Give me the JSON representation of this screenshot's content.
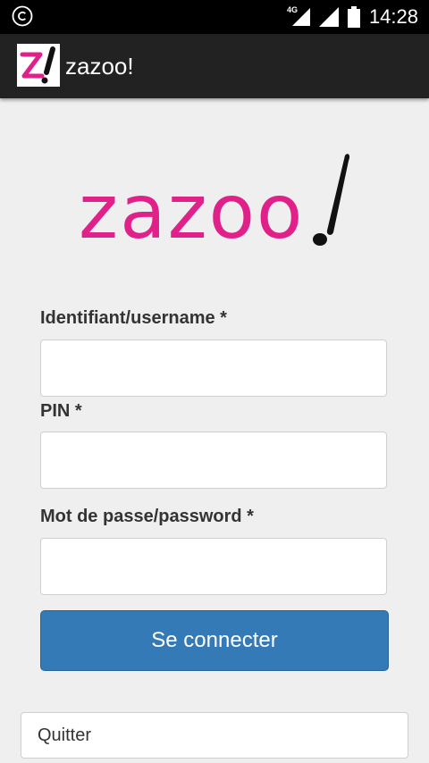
{
  "status_bar": {
    "time": "14:28",
    "network_label": "4G",
    "icons": [
      "copyright-icon",
      "signal-4g-icon",
      "signal-icon",
      "battery-icon"
    ]
  },
  "app_bar": {
    "title": "zazoo!",
    "icon_letter": "z"
  },
  "logo": {
    "wordmark": "zazoo",
    "exclamation": "!",
    "brand_color": "#e0218a"
  },
  "form": {
    "username_label": "Identifiant/username *",
    "username_value": "",
    "pin_label": "PIN *",
    "pin_value": "",
    "password_label": "Mot de passe/password *",
    "password_value": "",
    "submit_label": "Se connecter",
    "quit_label": "Quitter"
  },
  "colors": {
    "primary_button": "#337ab7",
    "background": "#efefef",
    "app_bar": "#222222"
  }
}
